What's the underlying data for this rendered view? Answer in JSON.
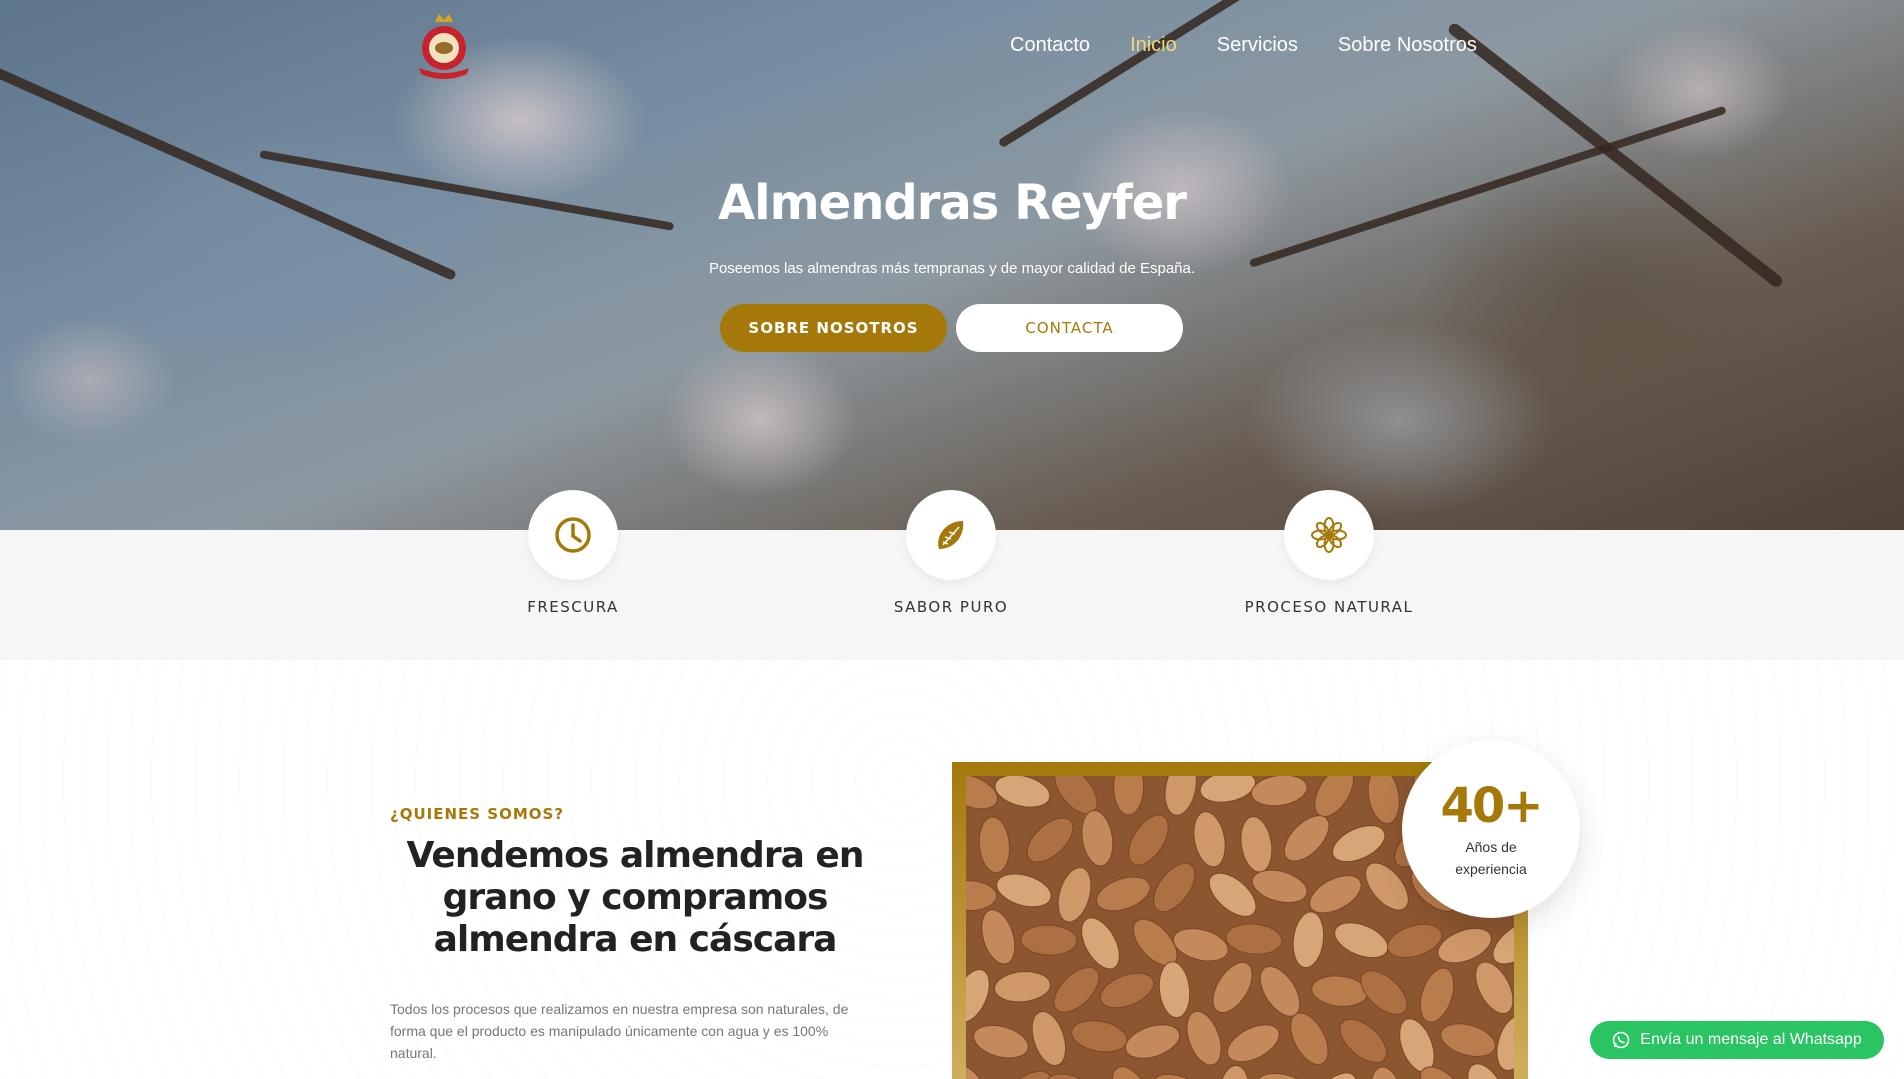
{
  "header": {
    "logo_alt": "REYFER",
    "nav": [
      {
        "label": "Contacto"
      },
      {
        "label": "Inicio"
      },
      {
        "label": "Servicios"
      },
      {
        "label": "Sobre Nosotros"
      }
    ],
    "active_nav": "Inicio"
  },
  "hero": {
    "title": "Almendras Reyfer",
    "subtitle": "Poseemos las almendras más tempranas y de mayor calidad de España.",
    "primary_button": "SOBRE NOSOTROS",
    "secondary_button": "CONTACTA"
  },
  "features": [
    {
      "label": "FRESCURA",
      "icon": "clock-icon"
    },
    {
      "label": "SABOR PURO",
      "icon": "almond-icon"
    },
    {
      "label": "PROCESO NATURAL",
      "icon": "flower-icon"
    }
  ],
  "about": {
    "eyebrow": "¿QUIENES SOMOS?",
    "title": "Vendemos almendra en grano y compramos almendra en cáscara",
    "text": "Todos los procesos que realizamos en nuestra empresa son naturales, de forma que el producto es manipulado únicamente con agua y es 100% natural.",
    "badge_number": "40+",
    "badge_label": "Años de experiencia"
  },
  "whatsapp": {
    "label": "Envía un mensaje al Whatsapp",
    "icon": "whatsapp-icon"
  },
  "colors": {
    "accent": "#a4790a",
    "active_nav": "#f2d87a",
    "whatsapp": "#2ac463"
  }
}
